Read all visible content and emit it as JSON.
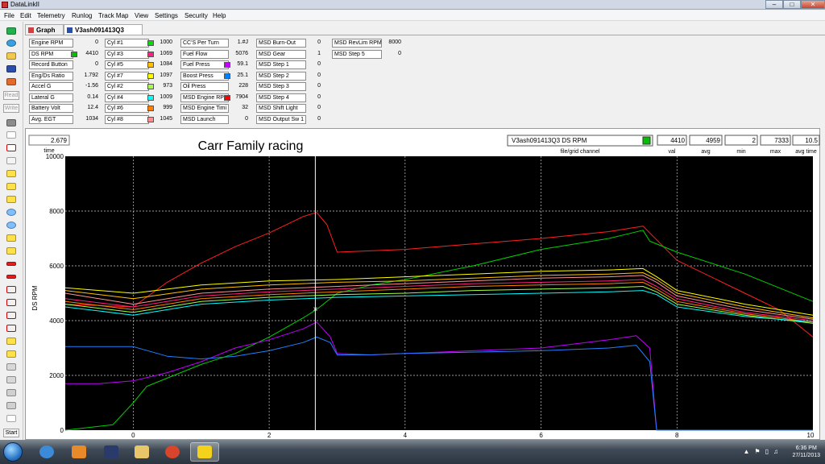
{
  "window": {
    "title": "DataLinkII",
    "min": "–",
    "max": "□",
    "close": "✕"
  },
  "menu": [
    "File",
    "Edit",
    "Telemetry",
    "Runlog",
    "Track Map",
    "View",
    "Settings",
    "Security",
    "Help"
  ],
  "toolbar": {
    "read_label": "Read",
    "write_label": "Write",
    "start_label": "Start"
  },
  "tabs": [
    {
      "label": "Graph"
    },
    {
      "label": "V3ash091413Q3"
    }
  ],
  "channels": [
    {
      "label": "Engine RPM",
      "value": "0",
      "color": ""
    },
    {
      "label": "DS RPM",
      "value": "4410",
      "color": "#00c000"
    },
    {
      "label": "Record Button",
      "value": "0",
      "color": ""
    },
    {
      "label": "Eng/Ds Ratio",
      "value": "1.792",
      "color": ""
    },
    {
      "label": "Accel G",
      "value": "-1.56",
      "color": ""
    },
    {
      "label": "Lateral G",
      "value": "0.14",
      "color": ""
    },
    {
      "label": "Battery Volt",
      "value": "12.4",
      "color": ""
    },
    {
      "label": "Avg. EGT",
      "value": "1034",
      "color": ""
    },
    {
      "label": "Cyl #1",
      "value": "1000",
      "color": "#00e000"
    },
    {
      "label": "Cyl #3",
      "value": "1069",
      "color": "#ff2080"
    },
    {
      "label": "Cyl #5",
      "value": "1084",
      "color": "#ffc000"
    },
    {
      "label": "Cyl #7",
      "value": "1097",
      "color": "#ffff00"
    },
    {
      "label": "Cyl #2",
      "value": "973",
      "color": "#a0ff40"
    },
    {
      "label": "Cyl #4",
      "value": "1009",
      "color": "#00ffff"
    },
    {
      "label": "Cyl #6",
      "value": "999",
      "color": "#ff8000"
    },
    {
      "label": "Cyl #8",
      "value": "1045",
      "color": "#ff9090"
    },
    {
      "label": "CC'S Per Turn",
      "value": "1.#J",
      "color": ""
    },
    {
      "label": "Fuel Flow",
      "value": "5076",
      "color": ""
    },
    {
      "label": "Fuel Press",
      "value": "59.1",
      "color": "#c000ff"
    },
    {
      "label": "Boost Press",
      "value": "25.1",
      "color": "#0080ff"
    },
    {
      "label": "Oil Press",
      "value": "228",
      "color": ""
    },
    {
      "label": "MSD Engine RPM",
      "value": "7904",
      "color": "#ff0000"
    },
    {
      "label": "MSD Engine Timi",
      "value": "32",
      "color": ""
    },
    {
      "label": "MSD Launch",
      "value": "0",
      "color": ""
    },
    {
      "label": "MSD Burn-Out",
      "value": "0",
      "color": ""
    },
    {
      "label": "MSD Gear",
      "value": "1",
      "color": ""
    },
    {
      "label": "MSD Step 1",
      "value": "0",
      "color": ""
    },
    {
      "label": "MSD Step 2",
      "value": "0",
      "color": ""
    },
    {
      "label": "MSD Step 3",
      "value": "0",
      "color": ""
    },
    {
      "label": "MSD Step 4",
      "value": "0",
      "color": ""
    },
    {
      "label": "MSD Shift Light",
      "value": "0",
      "color": ""
    },
    {
      "label": "MSD Output Sw 1",
      "value": "0",
      "color": ""
    },
    {
      "label": "MSD RevLim RPM",
      "value": "8000",
      "color": ""
    },
    {
      "label": "MSD Step 5",
      "value": "0",
      "color": ""
    }
  ],
  "graph_header": {
    "time_value": "2.679",
    "time_label": "time",
    "graph_title": "Carr Family racing",
    "file_channel": "V3ash091413Q3    DS RPM",
    "file_channel_label": "file/grid channel",
    "file_channel_color": "#00c000",
    "stats": [
      {
        "value": "4410",
        "label": "val"
      },
      {
        "value": "4959",
        "label": "avg"
      },
      {
        "value": "2",
        "label": "min"
      },
      {
        "value": "7333",
        "label": "max"
      },
      {
        "value": "10.5",
        "label": "avg time"
      }
    ]
  },
  "chart_data": {
    "type": "line",
    "ylabel": "DS RPM",
    "xlim": [
      -1,
      10
    ],
    "ylim": [
      0,
      10000
    ],
    "xticks": [
      0,
      2,
      4,
      6,
      8,
      10
    ],
    "yticks": [
      0,
      2000,
      4000,
      6000,
      8000,
      10000
    ],
    "grid": true,
    "cursor_x": 2.679,
    "cursor_y": 4410,
    "series": [
      {
        "color": "#ff2020",
        "x": [
          -1,
          -0.5,
          0,
          0.5,
          1,
          1.5,
          2,
          2.5,
          2.7,
          2.85,
          3,
          4,
          5,
          6,
          7,
          7.5,
          7.6,
          8,
          9,
          9.5,
          10
        ],
        "y": [
          4600,
          4550,
          4500,
          5400,
          6100,
          6700,
          7200,
          7800,
          7950,
          7500,
          6500,
          6600,
          6800,
          7000,
          7250,
          7450,
          7200,
          6200,
          5000,
          4400,
          3400
        ]
      },
      {
        "color": "#00d000",
        "x": [
          -1,
          -0.3,
          0,
          0.2,
          0.5,
          1,
          1.5,
          2,
          2.5,
          2.7,
          3,
          3.5,
          4,
          5,
          6,
          7,
          7.5,
          7.6,
          8,
          9,
          10
        ],
        "y": [
          0,
          200,
          1000,
          1600,
          1900,
          2400,
          2800,
          3400,
          4100,
          4410,
          5000,
          5300,
          5500,
          6000,
          6600,
          7000,
          7300,
          6900,
          6500,
          5700,
          4700
        ]
      },
      {
        "color": "#ffff00",
        "x": [
          -1,
          0,
          1,
          2,
          3,
          4,
          5,
          6,
          7,
          7.5,
          7.7,
          8,
          9,
          10
        ],
        "y": [
          5200,
          5000,
          5300,
          5450,
          5500,
          5600,
          5700,
          5800,
          5850,
          5900,
          5600,
          5100,
          4600,
          4200
        ]
      },
      {
        "color": "#ffc000",
        "x": [
          -1,
          0,
          1,
          2,
          3,
          4,
          5,
          6,
          7,
          7.5,
          7.7,
          8,
          9,
          10
        ],
        "y": [
          5100,
          4800,
          5150,
          5300,
          5400,
          5450,
          5550,
          5650,
          5700,
          5750,
          5500,
          5000,
          4500,
          4100
        ]
      },
      {
        "color": "#ff9090",
        "x": [
          -1,
          0,
          1,
          2,
          3,
          4,
          5,
          6,
          7,
          7.5,
          7.7,
          8,
          9,
          10
        ],
        "y": [
          5000,
          4600,
          5000,
          5150,
          5250,
          5350,
          5450,
          5550,
          5600,
          5650,
          5400,
          4900,
          4400,
          4050
        ]
      },
      {
        "color": "#ff2080",
        "x": [
          -1,
          0,
          1,
          2,
          3,
          4,
          5,
          6,
          7,
          7.5,
          7.7,
          8,
          9,
          10
        ],
        "y": [
          4800,
          4500,
          4900,
          5050,
          5150,
          5250,
          5350,
          5400,
          5450,
          5500,
          5250,
          4800,
          4300,
          4000
        ]
      },
      {
        "color": "#ff8000",
        "x": [
          -1,
          0,
          1,
          2,
          3,
          4,
          5,
          6,
          7,
          7.5,
          7.7,
          8,
          9,
          10
        ],
        "y": [
          4700,
          4400,
          4800,
          4950,
          5050,
          5150,
          5250,
          5300,
          5350,
          5400,
          5150,
          4700,
          4250,
          3950
        ]
      },
      {
        "color": "#a0ff40",
        "x": [
          -1,
          0,
          1,
          2,
          3,
          4,
          5,
          6,
          7,
          7.5,
          7.7,
          8,
          9,
          10
        ],
        "y": [
          4600,
          4300,
          4700,
          4850,
          4950,
          5000,
          5100,
          5150,
          5200,
          5250,
          5050,
          4600,
          4200,
          3900
        ]
      },
      {
        "color": "#00ffff",
        "x": [
          -1,
          0,
          1,
          2,
          3,
          4,
          5,
          6,
          7,
          7.5,
          7.7,
          8,
          9,
          10
        ],
        "y": [
          4500,
          4200,
          4600,
          4750,
          4850,
          4900,
          4950,
          5000,
          5050,
          5100,
          4950,
          4500,
          4150,
          3950
        ]
      },
      {
        "color": "#c000ff",
        "x": [
          -1,
          -0.5,
          0,
          0.5,
          1,
          1.5,
          2,
          2.5,
          2.7,
          2.9,
          3,
          3.5,
          4,
          5,
          6,
          7,
          7.4,
          7.6,
          7.7,
          8,
          10
        ],
        "y": [
          1700,
          1700,
          1800,
          2100,
          2500,
          3000,
          3300,
          3700,
          3950,
          3400,
          2800,
          2750,
          2800,
          2900,
          3000,
          3300,
          3450,
          3000,
          0,
          0,
          0
        ]
      },
      {
        "color": "#2080ff",
        "x": [
          -1,
          0,
          0.5,
          1,
          1.5,
          2,
          2.5,
          2.7,
          2.9,
          3,
          3.5,
          4,
          5,
          6,
          7,
          7.4,
          7.6,
          7.7,
          8,
          10
        ],
        "y": [
          3050,
          3050,
          2700,
          2600,
          2700,
          2900,
          3200,
          3400,
          3200,
          2750,
          2750,
          2800,
          2850,
          2900,
          3000,
          3100,
          2500,
          0,
          0,
          0
        ]
      }
    ]
  },
  "taskbar": {
    "time": "6:36 PM",
    "date": "27/11/2013",
    "tray_up": "▲"
  }
}
